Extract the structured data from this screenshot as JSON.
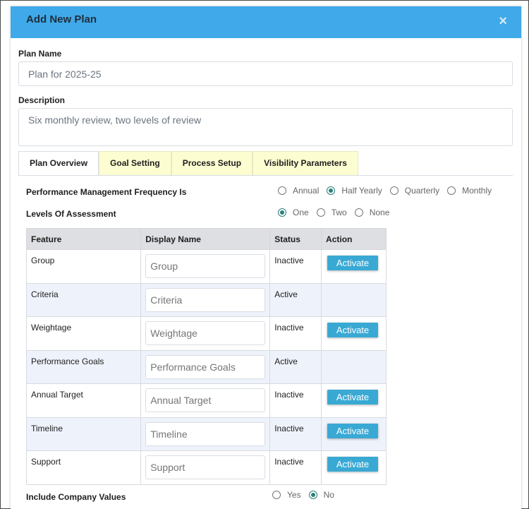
{
  "modal": {
    "title": "Add New Plan",
    "close_symbol": "×"
  },
  "plan_name": {
    "label": "Plan Name",
    "value": "Plan for 2025-25"
  },
  "description": {
    "label": "Description",
    "value": "Six monthly review, two levels of review"
  },
  "tabs": [
    {
      "label": "Plan Overview",
      "active": true
    },
    {
      "label": "Goal Setting",
      "active": false
    },
    {
      "label": "Process Setup",
      "active": false
    },
    {
      "label": "Visibility Parameters",
      "active": false
    }
  ],
  "frequency": {
    "label": "Performance Management Frequency Is",
    "options": [
      "Annual",
      "Half Yearly",
      "Quarterly",
      "Monthly"
    ],
    "selected": "Half Yearly"
  },
  "levels": {
    "label": "Levels Of Assessment",
    "options": [
      "One",
      "Two",
      "None"
    ],
    "selected": "One"
  },
  "table": {
    "headers": [
      "Feature",
      "Display Name",
      "Status",
      "Action"
    ],
    "rows": [
      {
        "feature": "Group",
        "placeholder": "Group",
        "status": "Inactive",
        "action": "Activate"
      },
      {
        "feature": "Criteria",
        "placeholder": "Criteria",
        "status": "Active",
        "action": ""
      },
      {
        "feature": "Weightage",
        "placeholder": "Weightage",
        "status": "Inactive",
        "action": "Activate"
      },
      {
        "feature": "Performance Goals",
        "placeholder": "Performance Goals",
        "status": "Active",
        "action": ""
      },
      {
        "feature": "Annual Target",
        "placeholder": "Annual Target",
        "status": "Inactive",
        "action": "Activate"
      },
      {
        "feature": "Timeline",
        "placeholder": "Timeline",
        "status": "Inactive",
        "action": "Activate"
      },
      {
        "feature": "Support",
        "placeholder": "Support",
        "status": "Inactive",
        "action": "Activate"
      }
    ]
  },
  "company_values": {
    "label": "Include Company Values",
    "options": [
      "Yes",
      "No"
    ],
    "selected": "No"
  },
  "colors": {
    "header_bg": "#3fa9e9",
    "tab_inactive_bg": "#fdfdd2",
    "activate_button": "#39a9d4",
    "radio_checked": "#2a7f7a",
    "row_alt_bg": "#eef2fa"
  },
  "icons": {
    "close": "close-icon"
  }
}
